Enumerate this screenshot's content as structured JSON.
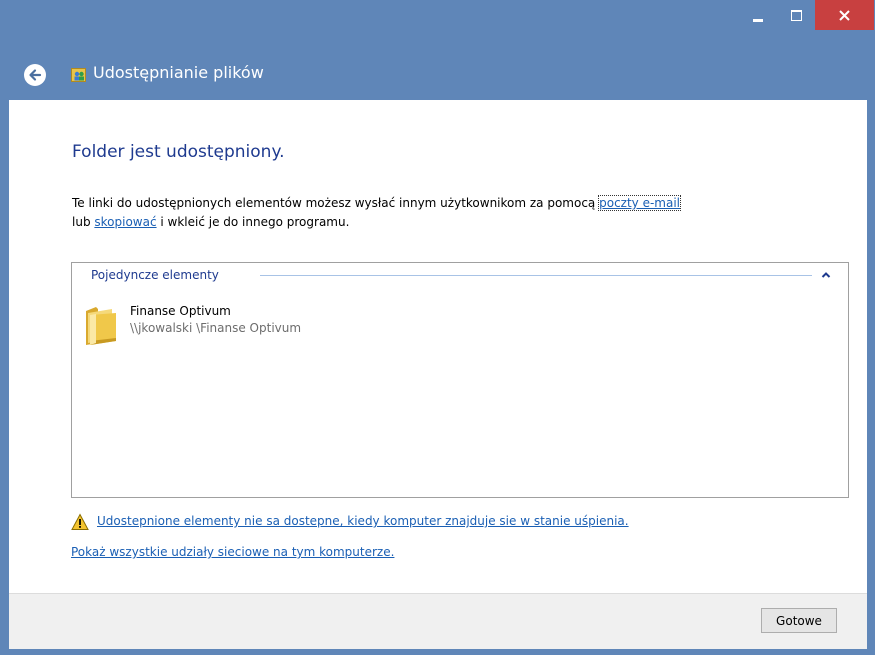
{
  "window": {
    "controls": {
      "minimize": "minimize-icon",
      "maximize": "maximize-icon",
      "close": "close-icon"
    },
    "accent_close": "#c84040"
  },
  "nav": {
    "title": "Udostępnianie plików",
    "back_icon": "back-arrow-icon",
    "app_icon": "sharing-users-icon"
  },
  "content": {
    "heading": "Folder jest udostępniony.",
    "desc_part1": "Te linki do udostępnionych elementów możesz wysłać innym użytkownikom za pomocą ",
    "email_link": "poczty e-mail",
    "desc_part2": "lub ",
    "copy_link": "skopiować",
    "desc_part3": " i wkleić je do innego programu.",
    "group": {
      "label": "Pojedyncze elementy",
      "chevron": "chevron-up-icon"
    },
    "items": [
      {
        "name": "Finanse Optivum",
        "path": "\\\\jkowalski \\Finanse Optivum",
        "icon": "folder-icon"
      }
    ],
    "warning_link": "Udostepnione elementy nie sa dostepne, kiedy komputer znajduje sie w stanie uśpienia.",
    "warning_icon": "warning-icon",
    "network_link": "Pokaż wszystkie udziały sieciowe na tym komputerze."
  },
  "footer": {
    "done_label": "Gotowe"
  },
  "colors": {
    "frame": "#5f86b8",
    "heading": "#1e3a8f",
    "link": "#1a5fb4"
  }
}
